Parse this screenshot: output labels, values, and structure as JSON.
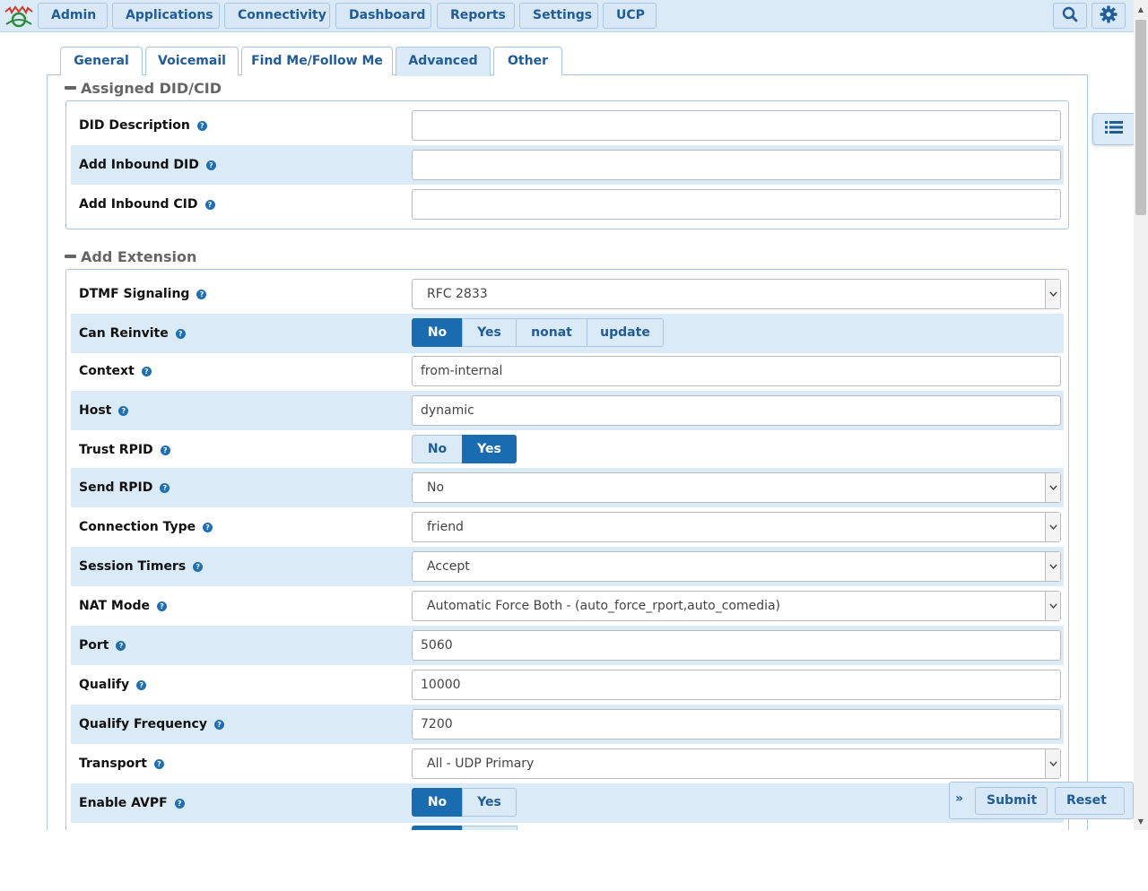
{
  "nav": {
    "items": [
      "Admin",
      "Applications",
      "Connectivity",
      "Dashboard",
      "Reports",
      "Settings",
      "UCP"
    ],
    "search_icon": "search-icon",
    "settings_icon": "gear-icon",
    "logo": "freepbx-logo",
    "colors": {
      "bar": "#dbeaf7",
      "text": "#1f5c99",
      "accent": "#1a6cb0"
    }
  },
  "tabs": {
    "items": [
      "General",
      "Voicemail",
      "Find Me/Follow Me",
      "Advanced",
      "Other"
    ],
    "active": "Advanced"
  },
  "section_did": {
    "title": "Assigned DID/CID",
    "fields": [
      {
        "label": "DID Description",
        "value": ""
      },
      {
        "label": "Add Inbound DID",
        "value": ""
      },
      {
        "label": "Add Inbound CID",
        "value": ""
      }
    ]
  },
  "section_ext": {
    "title": "Add Extension",
    "dtmf": {
      "label": "DTMF Signaling",
      "value": "RFC 2833"
    },
    "reinvite": {
      "label": "Can Reinvite",
      "options": [
        "No",
        "Yes",
        "nonat",
        "update"
      ],
      "selected": "No"
    },
    "context": {
      "label": "Context",
      "value": "from-internal"
    },
    "host": {
      "label": "Host",
      "value": "dynamic"
    },
    "trust_rpid": {
      "label": "Trust RPID",
      "options": [
        "No",
        "Yes"
      ],
      "selected": "Yes"
    },
    "send_rpid": {
      "label": "Send RPID",
      "value": "No"
    },
    "conn_type": {
      "label": "Connection Type",
      "value": "friend"
    },
    "session_timers": {
      "label": "Session Timers",
      "value": "Accept"
    },
    "nat_mode": {
      "label": "NAT Mode",
      "value": "Automatic Force Both - (auto_force_rport,auto_comedia)"
    },
    "port": {
      "label": "Port",
      "value": "5060"
    },
    "qualify": {
      "label": "Qualify",
      "value": "10000"
    },
    "qualify_freq": {
      "label": "Qualify Frequency",
      "value": "7200"
    },
    "transport": {
      "label": "Transport",
      "value": "All - UDP Primary"
    },
    "avpf": {
      "label": "Enable AVPF",
      "options": [
        "No",
        "Yes"
      ],
      "selected": "No"
    }
  },
  "actions": {
    "submit": "Submit",
    "reset": "Reset",
    "expand_glyph": "»"
  },
  "help_glyph": "?"
}
